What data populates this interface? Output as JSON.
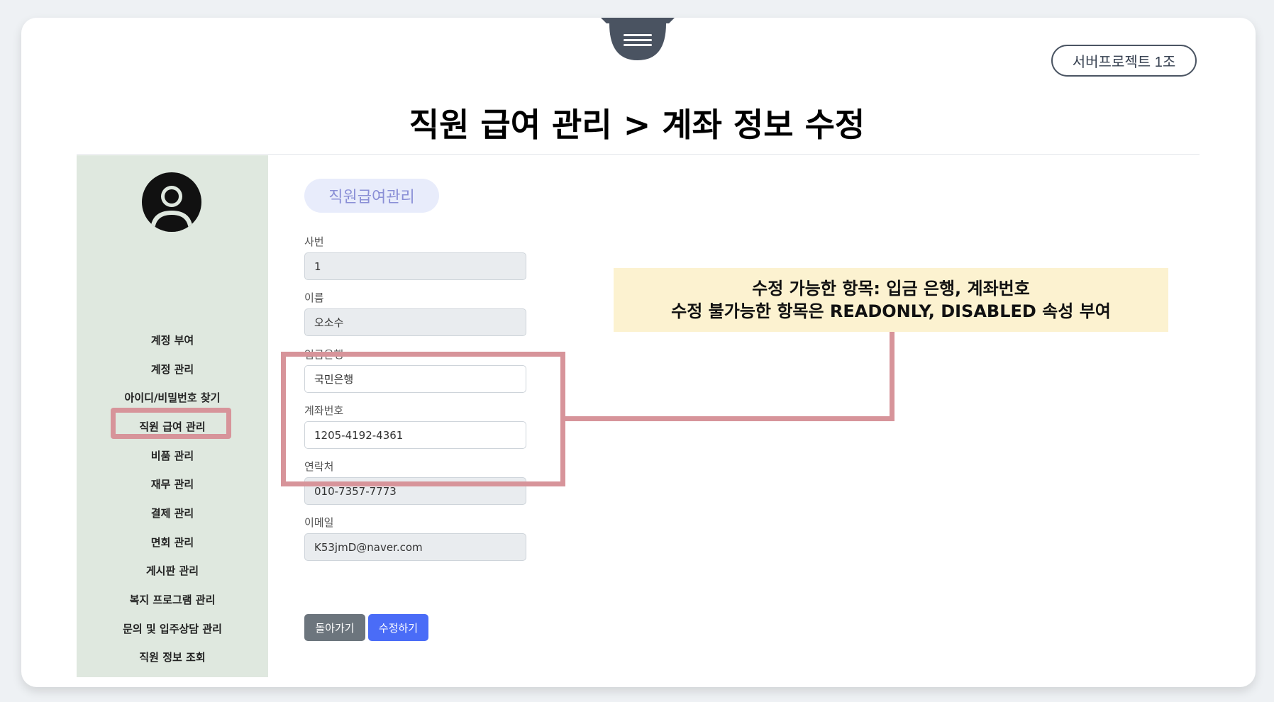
{
  "header": {
    "project_badge": "서버프로젝트 1조",
    "page_title": "직원 급여 관리 > 계좌 정보 수정"
  },
  "sidebar": {
    "items": [
      {
        "label": "계정 부여"
      },
      {
        "label": "계정 관리"
      },
      {
        "label": "아이디/비밀번호 찾기"
      },
      {
        "label": "직원 급여 관리"
      },
      {
        "label": "비품 관리"
      },
      {
        "label": "재무 관리"
      },
      {
        "label": "결제 관리"
      },
      {
        "label": "면회 관리"
      },
      {
        "label": "게시판 관리"
      },
      {
        "label": "복지 프로그램 관리"
      },
      {
        "label": "문의 및 입주상담 관리"
      },
      {
        "label": "직원 정보 조회"
      }
    ],
    "active_index": 3
  },
  "form": {
    "section_pill": "직원급여관리",
    "fields": {
      "emp_no": {
        "label": "사번",
        "value": "1"
      },
      "name": {
        "label": "이름",
        "value": "오소수"
      },
      "bank": {
        "label": "입금은행",
        "value": "국민은행"
      },
      "account": {
        "label": "계좌번호",
        "value": "1205-4192-4361"
      },
      "contact": {
        "label": "연락처",
        "value": "010-7357-7773"
      },
      "email": {
        "label": "이메일",
        "value": "K53jmD@naver.com"
      }
    },
    "buttons": {
      "back": "돌아가기",
      "submit": "수정하기"
    }
  },
  "annotation": {
    "line1": "수정 가능한 항목: 입금 은행, 계좌번호",
    "line2": "수정 불가능한 항목은 READONLY, DISABLED 속성 부여"
  },
  "colors": {
    "highlight": "#d7949a",
    "sidebar_bg": "#dfe8df",
    "note_bg": "#fcf2d0",
    "pill_bg": "#e8ecfb",
    "submit": "#4a6cf7",
    "back": "#6c757d"
  },
  "icons": {
    "menu": "hamburger-icon",
    "avatar": "user-avatar-icon"
  }
}
